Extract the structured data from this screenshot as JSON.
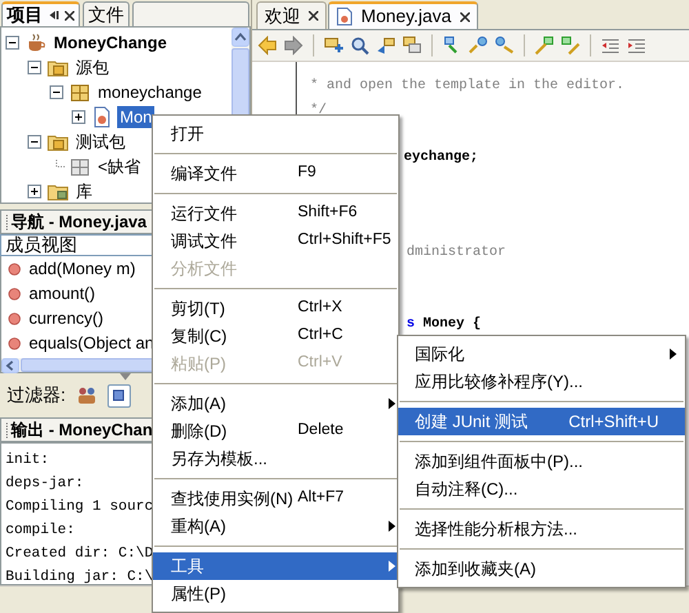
{
  "project_panel": {
    "tabs": [
      {
        "label": "项目",
        "selected": true
      },
      {
        "label": "文件",
        "selected": false
      }
    ],
    "tree": [
      {
        "label": "MoneyChange",
        "kind": "project",
        "expanded": true,
        "selected": false,
        "children": [
          {
            "label": "源包",
            "kind": "source_folder",
            "expanded": true,
            "selected": false,
            "children": [
              {
                "label": "moneychange",
                "kind": "package",
                "expanded": true,
                "selected": false,
                "children": [
                  {
                    "label": "Mon",
                    "kind": "java",
                    "expanded": false,
                    "selected": true
                  }
                ]
              }
            ]
          },
          {
            "label": "测试包",
            "kind": "source_folder",
            "expanded": true,
            "selected": false,
            "children": [
              {
                "label": "<缺省",
                "kind": "empty_package",
                "selected": false
              }
            ]
          },
          {
            "label": "库",
            "kind": "library",
            "expanded": false,
            "selected": false
          }
        ]
      }
    ]
  },
  "navigator": {
    "title": "导航 - Money.java",
    "view": "成员视图",
    "members": [
      "add(Money m)",
      "amount()",
      "currency()",
      "equals(Object an"
    ],
    "filter_label": "过滤器:"
  },
  "output": {
    "title": "输出 - MoneyChan",
    "lines": [
      "init:",
      "deps-jar:",
      "Compiling 1 sourc",
      "compile:",
      "Created dir: C:\\D",
      "Building jar: C:\\"
    ]
  },
  "editor": {
    "tabs": [
      {
        "label": "欢迎",
        "selected": false
      },
      {
        "label": "Money.java",
        "selected": true
      }
    ],
    "code": [
      {
        "parts": [
          {
            "kind": "comment",
            "text": "* and open the template in the editor."
          }
        ]
      },
      {
        "parts": [
          {
            "kind": "comment",
            "text": "*/"
          }
        ]
      },
      {
        "parts": [
          {
            "kind": "plain",
            "text": "eychange;"
          }
        ]
      },
      {
        "parts": [
          {
            "kind": "comment",
            "text": "dministrator"
          }
        ]
      },
      {
        "parts": [
          {
            "kind": "keyword",
            "text": "s"
          },
          {
            "kind": "plain",
            "text": "Money {"
          }
        ]
      }
    ]
  },
  "context_menu": {
    "groups": [
      [
        {
          "label": "打开",
          "selected": false,
          "disabled": false,
          "submenu": false
        }
      ],
      [
        {
          "label": "编译文件",
          "shortcut": "F9",
          "selected": false,
          "disabled": false,
          "submenu": false
        }
      ],
      [
        {
          "label": "运行文件",
          "shortcut": "Shift+F6",
          "selected": false,
          "disabled": false,
          "submenu": false
        },
        {
          "label": "调试文件",
          "shortcut": "Ctrl+Shift+F5",
          "selected": false,
          "disabled": false,
          "submenu": false
        },
        {
          "label": "分析文件",
          "selected": false,
          "disabled": true,
          "submenu": false
        }
      ],
      [
        {
          "label": "剪切(T)",
          "shortcut": "Ctrl+X",
          "selected": false,
          "disabled": false,
          "submenu": false
        },
        {
          "label": "复制(C)",
          "shortcut": "Ctrl+C",
          "selected": false,
          "disabled": false,
          "submenu": false
        },
        {
          "label": "粘贴(P)",
          "shortcut": "Ctrl+V",
          "selected": false,
          "disabled": true,
          "submenu": false
        }
      ],
      [
        {
          "label": "添加(A)",
          "selected": false,
          "disabled": false,
          "submenu": true
        },
        {
          "label": "删除(D)",
          "shortcut": "Delete",
          "selected": false,
          "disabled": false,
          "submenu": false
        },
        {
          "label": "另存为模板...",
          "selected": false,
          "disabled": false,
          "submenu": false
        }
      ],
      [
        {
          "label": "查找使用实例(N)",
          "shortcut": "Alt+F7",
          "selected": false,
          "disabled": false,
          "submenu": false
        },
        {
          "label": "重构(A)",
          "selected": false,
          "disabled": false,
          "submenu": true
        }
      ],
      [
        {
          "label": "工具",
          "selected": true,
          "disabled": false,
          "submenu": true
        },
        {
          "label": "属性(P)",
          "selected": false,
          "disabled": false,
          "submenu": false
        }
      ]
    ]
  },
  "submenu": {
    "groups": [
      [
        {
          "label": "国际化",
          "selected": false,
          "submenu": true
        },
        {
          "label": "应用比较修补程序(Y)...",
          "selected": false,
          "submenu": false
        }
      ],
      [
        {
          "label": "创建 JUnit 测试",
          "shortcut": "Ctrl+Shift+U",
          "selected": true,
          "submenu": false
        }
      ],
      [
        {
          "label": "添加到组件面板中(P)...",
          "selected": false,
          "submenu": false
        },
        {
          "label": "自动注释(C)...",
          "selected": false,
          "submenu": false
        }
      ],
      [
        {
          "label": "选择性能分析根方法...",
          "selected": false,
          "submenu": false
        }
      ],
      [
        {
          "label": "添加到收藏夹(A)",
          "selected": false,
          "submenu": false
        }
      ]
    ]
  }
}
